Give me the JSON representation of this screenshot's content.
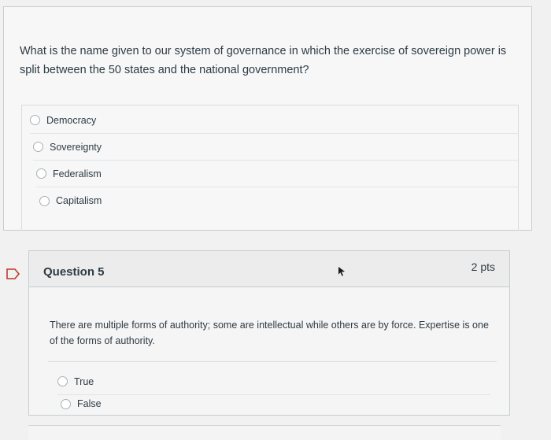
{
  "question4": {
    "text": "What is the name given to our system of governance in which the exercise of sovereign power is split between the 50 states and the national government?",
    "answers": [
      {
        "label": "Democracy"
      },
      {
        "label": "Sovereignty"
      },
      {
        "label": "Federalism"
      },
      {
        "label": "Capitalism"
      }
    ]
  },
  "question5": {
    "title": "Question 5",
    "points": "2 pts",
    "text": "There are multiple forms of authority; some are intellectual while others are by force. Expertise is one of the forms of authority.",
    "answers": [
      {
        "label": "True"
      },
      {
        "label": "False"
      }
    ]
  },
  "icons": {
    "flag": "flag-icon",
    "cursor": "mouse-pointer-icon"
  }
}
